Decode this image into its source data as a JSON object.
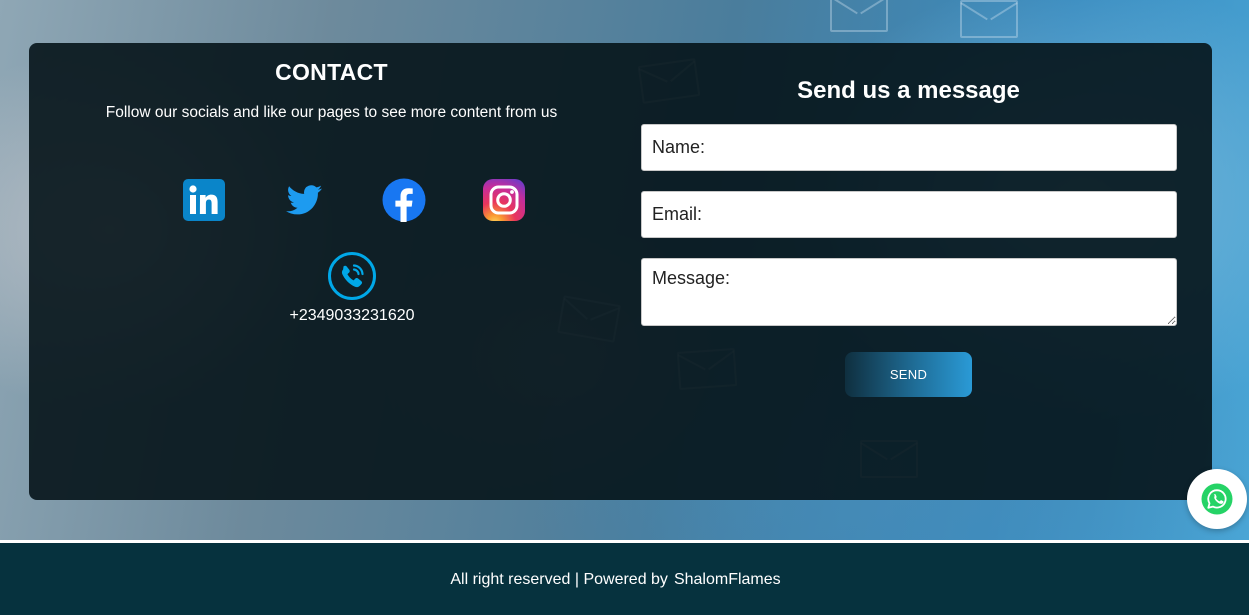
{
  "contact": {
    "title": "CONTACT",
    "tagline": "Follow our socials and like our pages to see more content from us",
    "socials": [
      {
        "name": "LinkedIn",
        "icon": "linkedin-icon",
        "color": "#0a85c9"
      },
      {
        "name": "Twitter",
        "icon": "twitter-icon",
        "color": "#1d9bf0"
      },
      {
        "name": "Facebook",
        "icon": "facebook-icon",
        "color": "#1877f2"
      },
      {
        "name": "Instagram",
        "icon": "instagram-icon",
        "color": "#e1306c"
      }
    ],
    "phone": {
      "icon": "phone-icon",
      "number": "+2349033231620",
      "color": "#00a8e8"
    }
  },
  "form": {
    "title": "Send us a message",
    "name_placeholder": "Name:",
    "email_placeholder": "Email:",
    "message_placeholder": "Message:",
    "submit_label": "SEND"
  },
  "footer": {
    "text": "All right reserved | Powered by",
    "brand": "ShalomFlames"
  },
  "floating": {
    "icon": "whatsapp-icon",
    "color": "#25d366"
  }
}
